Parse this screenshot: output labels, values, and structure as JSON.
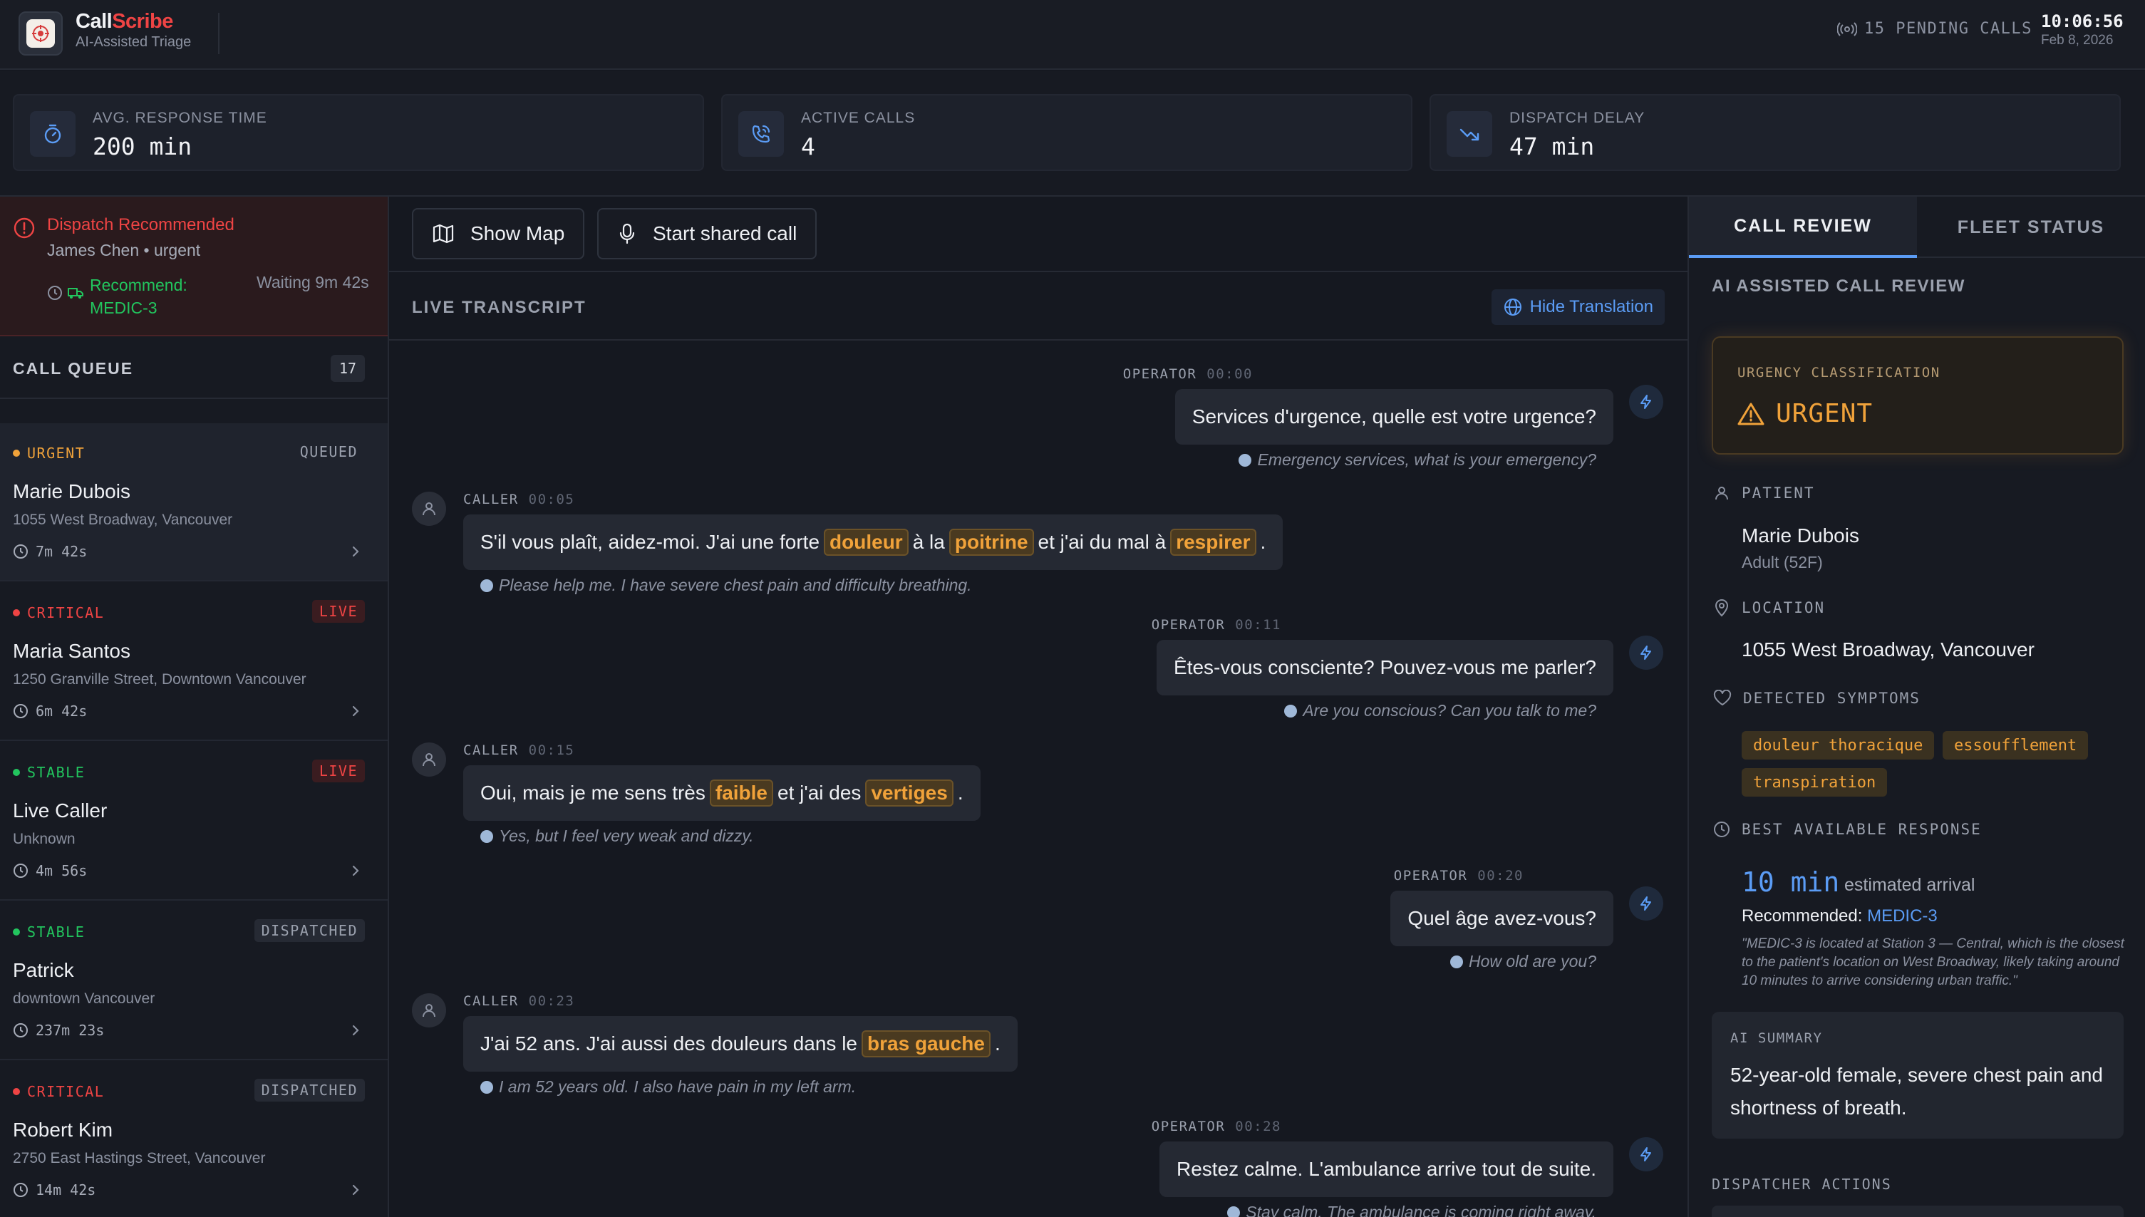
{
  "header": {
    "brand_part1": "Call",
    "brand_part2": "Scribe",
    "subtitle": "AI-Assisted Triage",
    "pending": "15 PENDING CALLS",
    "time": "10:06:56",
    "date": "Feb 8, 2026"
  },
  "stats": [
    {
      "label": "AVG. RESPONSE TIME",
      "value": "200 min",
      "icon": "stopwatch-icon"
    },
    {
      "label": "ACTIVE CALLS",
      "value": "4",
      "icon": "phone-call-icon"
    },
    {
      "label": "DISPATCH DELAY",
      "value": "47 min",
      "icon": "trending-down-icon"
    }
  ],
  "alert": {
    "title": "Dispatch Recommended",
    "subtitle": "James Chen • urgent",
    "recommend": "Recommend: MEDIC-3",
    "waiting": "Waiting 9m 42s"
  },
  "queue": {
    "title": "CALL QUEUE",
    "count": "17",
    "items": [
      {
        "severity": "URGENT",
        "status": "QUEUED",
        "name": "Marie Dubois",
        "address": "1055 West Broadway, Vancouver",
        "time": "7m 42s"
      },
      {
        "severity": "CRITICAL",
        "status": "LIVE",
        "name": "Maria Santos",
        "address": "1250 Granville Street, Downtown Vancouver",
        "time": "6m 42s"
      },
      {
        "severity": "STABLE",
        "status": "LIVE",
        "name": "Live Caller",
        "address": "Unknown",
        "time": "4m 56s"
      },
      {
        "severity": "STABLE",
        "status": "DISPATCHED",
        "name": "Patrick",
        "address": "downtown Vancouver",
        "time": "237m 23s"
      },
      {
        "severity": "CRITICAL",
        "status": "DISPATCHED",
        "name": "Robert Kim",
        "address": "2750 East Hastings Street, Vancouver",
        "time": "14m 42s"
      }
    ]
  },
  "toolbar": {
    "show_map": "Show Map",
    "start_call": "Start shared call"
  },
  "transcript": {
    "title": "LIVE TRANSCRIPT",
    "hide_translation": "Hide Translation",
    "messages": [
      {
        "speaker": "OPERATOR",
        "time": "00:00",
        "text": "Services d'urgence, quelle est votre urgence?",
        "translation": "Emergency services, what is your emergency?"
      },
      {
        "speaker": "CALLER",
        "time": "00:05",
        "parts": [
          "S'il vous plaît, aidez-moi. J'ai une forte",
          "douleur",
          "à la",
          "poitrine",
          "et j'ai du mal à",
          "respirer",
          "."
        ],
        "translation": "Please help me. I have severe chest pain and difficulty breathing."
      },
      {
        "speaker": "OPERATOR",
        "time": "00:11",
        "text": "Êtes-vous consciente? Pouvez-vous me parler?",
        "translation": "Are you conscious? Can you talk to me?"
      },
      {
        "speaker": "CALLER",
        "time": "00:15",
        "parts": [
          "Oui, mais je me sens très",
          "faible",
          "et j'ai des",
          "vertiges",
          "."
        ],
        "translation": "Yes, but I feel very weak and dizzy."
      },
      {
        "speaker": "OPERATOR",
        "time": "00:20",
        "text": "Quel âge avez-vous?",
        "translation": "How old are you?"
      },
      {
        "speaker": "CALLER",
        "time": "00:23",
        "parts": [
          "J'ai 52 ans. J'ai aussi des douleurs dans le",
          "bras gauche",
          "."
        ],
        "translation": "I am 52 years old. I also have pain in my left arm."
      },
      {
        "speaker": "OPERATOR",
        "time": "00:28",
        "text": "Restez calme. L'ambulance arrive tout de suite.",
        "translation": "Stay calm. The ambulance is coming right away."
      }
    ]
  },
  "review": {
    "tab_review": "CALL REVIEW",
    "tab_fleet": "FLEET STATUS",
    "title": "AI ASSISTED CALL REVIEW",
    "urgency_label": "URGENCY CLASSIFICATION",
    "urgency_value": "URGENT",
    "patient_label": "PATIENT",
    "patient_name": "Marie Dubois",
    "patient_sub": "Adult (52F)",
    "location_label": "LOCATION",
    "location_value": "1055 West Broadway, Vancouver",
    "symptoms_label": "DETECTED SYMPTOMS",
    "symptoms": [
      "douleur thoracique",
      "essoufflement",
      "transpiration"
    ],
    "response_label": "BEST AVAILABLE RESPONSE",
    "response_time": "10 min",
    "response_suffix": "estimated arrival",
    "recommended_prefix": "Recommended:",
    "recommended_unit": "MEDIC-3",
    "reason": "\"MEDIC-3 is located at Station 3 — Central, which is the closest to the patient's location on West Broadway, likely taking around 10 minutes to arrive considering urban traffic.\"",
    "summary_label": "AI SUMMARY",
    "summary_text": "52-year-old female, severe chest pain and shortness of breath.",
    "actions_label": "DISPATCHER ACTIONS"
  },
  "colors": {
    "accent_blue": "#5b9cf5",
    "urgent": "#f0a23a",
    "critical": "#ef4444",
    "stable": "#22c55e"
  }
}
